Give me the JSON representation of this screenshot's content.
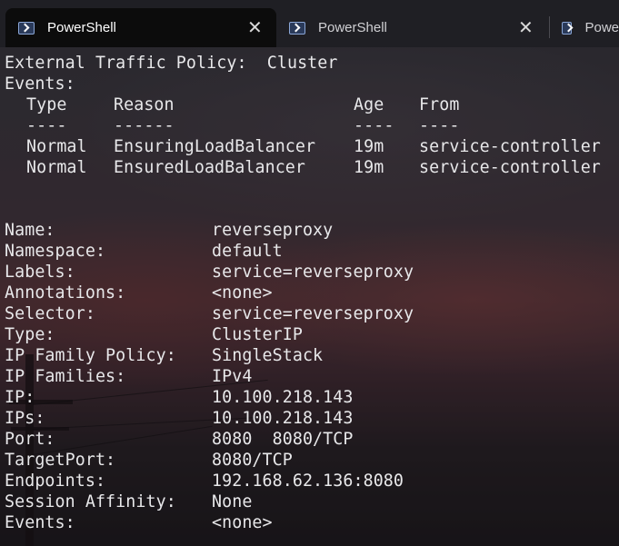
{
  "tabs": [
    {
      "label": "PowerShell",
      "active": true
    },
    {
      "label": "PowerShell",
      "active": false
    },
    {
      "label": "Powe",
      "active": false
    }
  ],
  "close_glyph": "✕",
  "header": {
    "external_traffic_policy": "External Traffic Policy:  Cluster",
    "events_label": "Events:"
  },
  "events_table": {
    "headers": {
      "type": "Type",
      "reason": "Reason",
      "age": "Age",
      "from": "From"
    },
    "dashes": {
      "type": "----",
      "reason": "------",
      "age": "----",
      "from": "----"
    },
    "rows": [
      {
        "type": "Normal",
        "reason": "EnsuringLoadBalancer",
        "age": "19m",
        "from": "service-controller"
      },
      {
        "type": "Normal",
        "reason": "EnsuredLoadBalancer",
        "age": "19m",
        "from": "service-controller"
      }
    ]
  },
  "service": [
    {
      "key": "Name:",
      "value": "reverseproxy"
    },
    {
      "key": "Namespace:",
      "value": "default"
    },
    {
      "key": "Labels:",
      "value": "service=reverseproxy"
    },
    {
      "key": "Annotations:",
      "value": "<none>"
    },
    {
      "key": "Selector:",
      "value": "service=reverseproxy"
    },
    {
      "key": "Type:",
      "value": "ClusterIP"
    },
    {
      "key": "IP Family Policy:",
      "value": "SingleStack"
    },
    {
      "key": "IP Families:",
      "value": "IPv4"
    },
    {
      "key": "IP:",
      "value": "10.100.218.143"
    },
    {
      "key": "IPs:",
      "value": "10.100.218.143"
    },
    {
      "key": "Port:",
      "value": "8080  8080/TCP"
    },
    {
      "key": "TargetPort:",
      "value": "8080/TCP"
    },
    {
      "key": "Endpoints:",
      "value": "192.168.62.136:8080"
    },
    {
      "key": "Session Affinity:",
      "value": "None"
    },
    {
      "key": "Events:",
      "value": "<none>"
    }
  ],
  "colors": {
    "text": "#e8e8ea",
    "tab_active_bg": "#0c0c0c",
    "tabbar_bg": "#1f1f24"
  }
}
